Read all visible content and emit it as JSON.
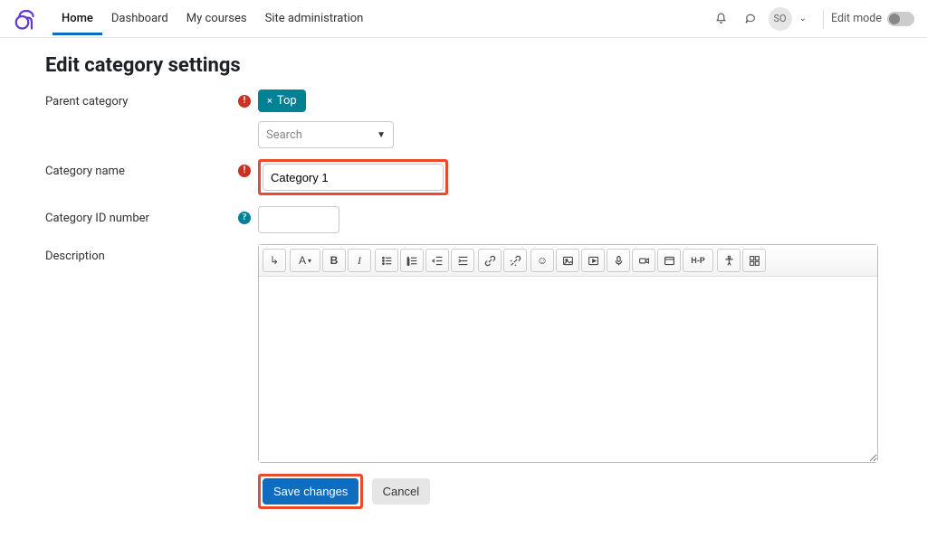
{
  "nav": {
    "home": "Home",
    "dashboard": "Dashboard",
    "mycourses": "My courses",
    "siteadmin": "Site administration",
    "avatar_initials": "SO",
    "edit_mode": "Edit mode"
  },
  "page": {
    "title": "Edit category settings"
  },
  "form": {
    "labels": {
      "parent": "Parent category",
      "name": "Category name",
      "idnumber": "Category ID number",
      "description": "Description"
    },
    "parent_tag": "Top",
    "parent_tag_close": "×",
    "search_placeholder": "Search",
    "name_value": "Category 1",
    "idnumber_value": "",
    "description_value": ""
  },
  "editor": {
    "font_label": "A",
    "bold": "B",
    "italic": "I",
    "h5p": "H-P"
  },
  "buttons": {
    "save": "Save changes",
    "cancel": "Cancel"
  },
  "colors": {
    "accent": "#0f6cbf",
    "teal": "#008196",
    "highlight": "#ec4a2c",
    "danger": "#ca3120"
  }
}
